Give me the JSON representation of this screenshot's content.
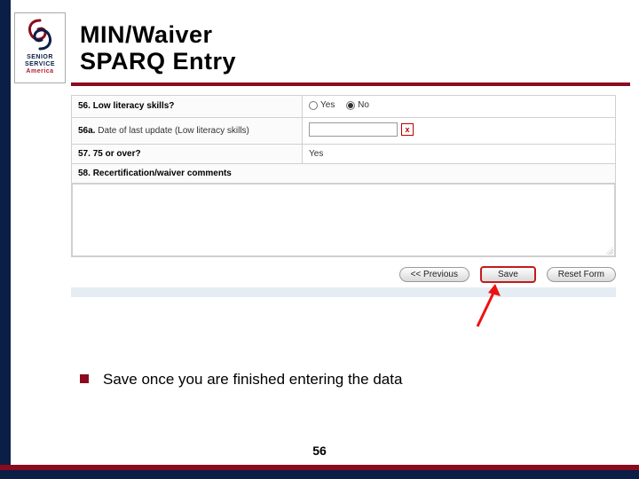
{
  "logo": {
    "line1": "SENIOR",
    "line2": "SERVICE",
    "line3": "America"
  },
  "title": {
    "line1": "MIN/Waiver",
    "line2": "SPARQ Entry"
  },
  "form": {
    "row56": {
      "num": "56.",
      "label": "Low literacy skills?",
      "yes": "Yes",
      "no": "No",
      "selected": "no"
    },
    "row56a": {
      "num": "56a.",
      "label": "Date of last update (Low literacy skills)",
      "cal": "x"
    },
    "row57": {
      "num": "57.",
      "label": "75 or over?",
      "value": "Yes"
    },
    "row58": {
      "num": "58.",
      "label": "Recertification/waiver comments"
    }
  },
  "buttons": {
    "prev": "<< Previous",
    "save": "Save",
    "reset": "Reset Form"
  },
  "bullet": "Save once you are finished entering the data",
  "page": "56"
}
